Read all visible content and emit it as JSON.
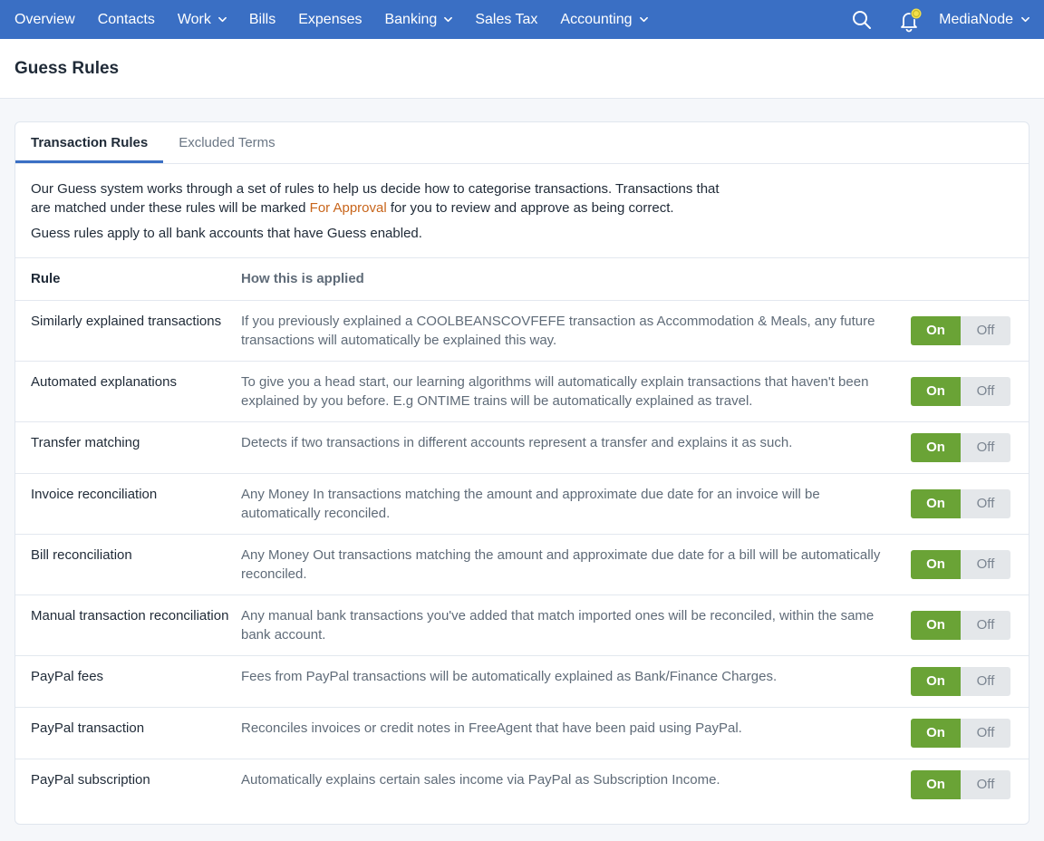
{
  "nav": {
    "items": [
      {
        "label": "Overview",
        "dropdown": false
      },
      {
        "label": "Contacts",
        "dropdown": false
      },
      {
        "label": "Work",
        "dropdown": true
      },
      {
        "label": "Bills",
        "dropdown": false
      },
      {
        "label": "Expenses",
        "dropdown": false
      },
      {
        "label": "Banking",
        "dropdown": true
      },
      {
        "label": "Sales Tax",
        "dropdown": false
      },
      {
        "label": "Accounting",
        "dropdown": true
      }
    ],
    "account": "MediaNode",
    "icons": {
      "search": "search-icon",
      "bell": "bell-icon"
    }
  },
  "page": {
    "title": "Guess Rules"
  },
  "tabs": [
    {
      "label": "Transaction Rules",
      "active": true
    },
    {
      "label": "Excluded Terms",
      "active": false
    }
  ],
  "intro": {
    "line1_prefix": "Our Guess system works through a set of rules to help us decide how to categorise transactions. Transactions that are matched under these rules will be marked ",
    "highlight": "For Approval",
    "line1_suffix": " for you to review and approve as being correct.",
    "line2": "Guess rules apply to all bank accounts that have Guess enabled."
  },
  "table": {
    "headers": {
      "rule": "Rule",
      "applied": "How this is applied"
    },
    "toggle_labels": {
      "on": "On",
      "off": "Off"
    },
    "rows": [
      {
        "rule": "Similarly explained transactions",
        "desc": "If you previously explained a COOLBEANSCOVFEFE transaction as Accommodation & Meals, any future transactions will automatically be explained this way.",
        "state": "on"
      },
      {
        "rule": "Automated explanations",
        "desc": "To give you a head start, our learning algorithms will automatically explain transactions that haven't been explained by you before. E.g ONTIME trains will be automatically explained as travel.",
        "state": "on"
      },
      {
        "rule": "Transfer matching",
        "desc": "Detects if two transactions in different accounts represent a transfer and explains it as such.",
        "state": "on"
      },
      {
        "rule": "Invoice reconciliation",
        "desc": "Any Money In transactions matching the amount and approximate due date for an invoice will be automatically reconciled.",
        "state": "on"
      },
      {
        "rule": "Bill reconciliation",
        "desc": "Any Money Out transactions matching the amount and approximate due date for a bill will be automatically reconciled.",
        "state": "on"
      },
      {
        "rule": "Manual transaction reconciliation",
        "desc": "Any manual bank transactions you've added that match imported ones will be reconciled, within the same bank account.",
        "state": "on"
      },
      {
        "rule": "PayPal fees",
        "desc": "Fees from PayPal transactions will be automatically explained as Bank/Finance Charges.",
        "state": "on"
      },
      {
        "rule": "PayPal transaction",
        "desc": "Reconciles invoices or credit notes in FreeAgent that have been paid using PayPal.",
        "state": "on"
      },
      {
        "rule": "PayPal subscription",
        "desc": "Automatically explains certain sales income via PayPal as Subscription Income.",
        "state": "on"
      }
    ]
  },
  "colors": {
    "nav_bg": "#3a6fc4",
    "on": "#6aa336",
    "highlight": "#c8651b"
  }
}
